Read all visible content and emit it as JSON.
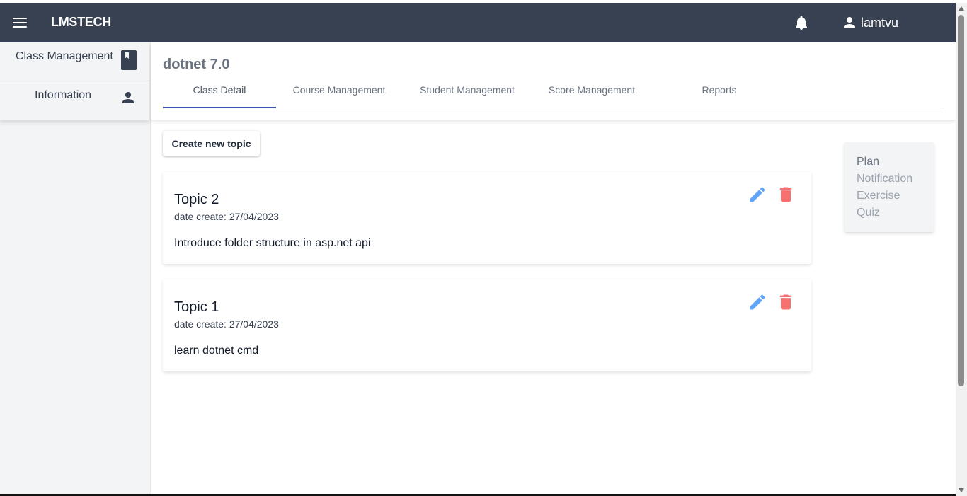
{
  "app": {
    "brand": "LMSTECH"
  },
  "header": {
    "username": "lamtvu"
  },
  "sidebar": {
    "items": [
      {
        "label": "Class Management",
        "icon": "book-icon"
      },
      {
        "label": "Information",
        "icon": "person-icon"
      }
    ]
  },
  "main": {
    "class_title": "dotnet 7.0",
    "tabs": [
      {
        "label": "Class Detail",
        "active": true
      },
      {
        "label": "Course Management",
        "active": false
      },
      {
        "label": "Student Management",
        "active": false
      },
      {
        "label": "Score Management",
        "active": false
      },
      {
        "label": "Reports",
        "active": false
      }
    ],
    "create_button": "Create new topic",
    "topics": [
      {
        "title": "Topic 2",
        "date": "date create: 27/04/2023",
        "description": "Introduce folder structure in asp.net api"
      },
      {
        "title": "Topic 1",
        "date": "date create: 27/04/2023",
        "description": "learn dotnet cmd"
      }
    ]
  },
  "right_nav": {
    "links": [
      {
        "label": "Plan",
        "active": true
      },
      {
        "label": "Notification",
        "active": false
      },
      {
        "label": "Exercise",
        "active": false
      },
      {
        "label": "Quiz",
        "active": false
      }
    ]
  },
  "colors": {
    "appbar": "#374151",
    "tab_indicator": "#3f51b5",
    "edit_icon": "#60a5fa",
    "delete_icon": "#f87171"
  }
}
